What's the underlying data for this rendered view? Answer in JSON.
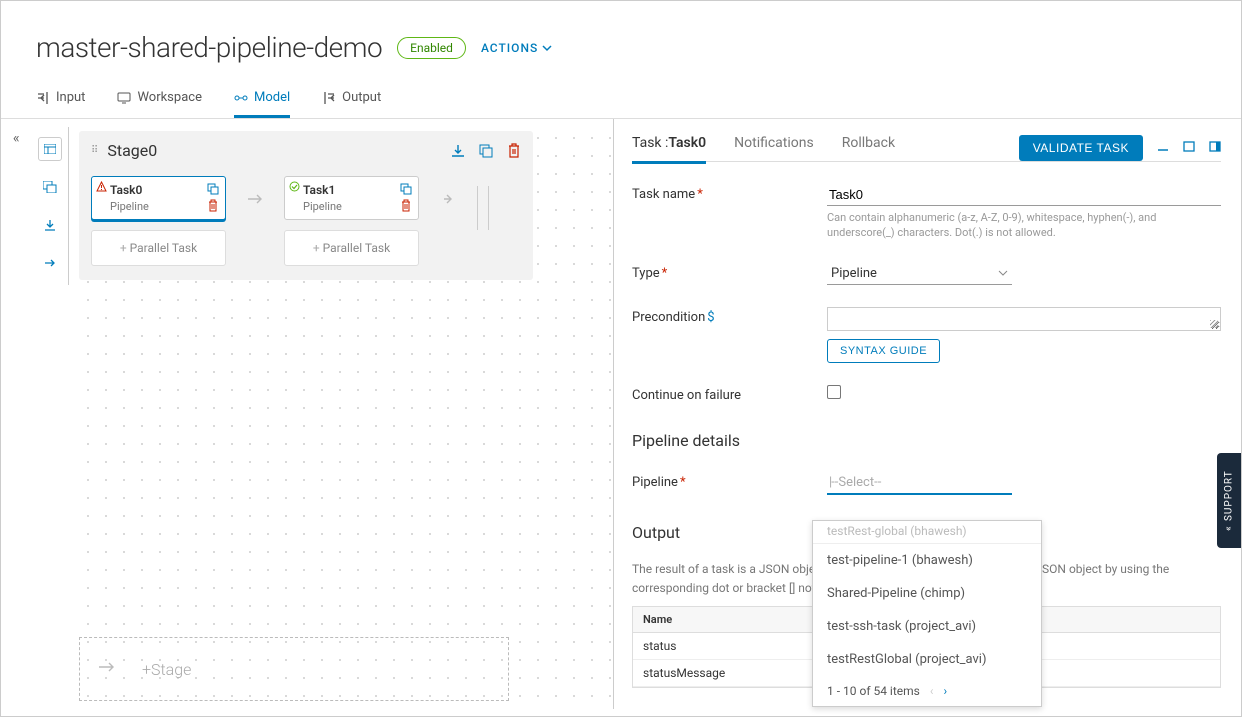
{
  "header": {
    "title": "master-shared-pipeline-demo",
    "status_badge": "Enabled",
    "actions_label": "ACTIONS"
  },
  "top_tabs": {
    "input": "Input",
    "workspace": "Workspace",
    "model": "Model",
    "output": "Output"
  },
  "stage": {
    "name": "Stage0",
    "task0": {
      "name": "Task0",
      "type": "Pipeline"
    },
    "task1": {
      "name": "Task1",
      "type": "Pipeline"
    },
    "parallel_label": "Parallel Task",
    "add_stage_label": "Stage"
  },
  "right": {
    "tabs": {
      "task_prefix": "Task :",
      "task_name": "Task0",
      "notifications": "Notifications",
      "rollback": "Rollback"
    },
    "validate_label": "VALIDATE TASK",
    "form": {
      "task_name_label": "Task name",
      "task_name_value": "Task0",
      "task_name_help": "Can contain alphanumeric (a-z, A-Z, 0-9), whitespace, hyphen(-), and underscore(_) characters. Dot(.) is not allowed.",
      "type_label": "Type",
      "type_value": "Pipeline",
      "precondition_label": "Precondition",
      "syntax_guide": "SYNTAX GUIDE",
      "continue_label": "Continue on failure",
      "pipeline_details_title": "Pipeline details",
      "pipeline_label": "Pipeline",
      "pipeline_placeholder": "--Select--",
      "output_title": "Output",
      "output_desc_a": "The result of a task is a JSON object",
      "output_desc_b": "JSON object by using the corresponding dot or bracket [] not",
      "table_name_header": "Name",
      "row_status": "status",
      "row_status_message": "statusMessage"
    }
  },
  "dropdown": {
    "faded": "testRest-global (bhawesh)",
    "items": [
      "test-pipeline-1 (bhawesh)",
      "Shared-Pipeline (chimp)",
      "test-ssh-task (project_avi)",
      "testRestGlobal (project_avi)"
    ],
    "pager": "1 - 10 of 54 items"
  },
  "support_label": "SUPPORT"
}
